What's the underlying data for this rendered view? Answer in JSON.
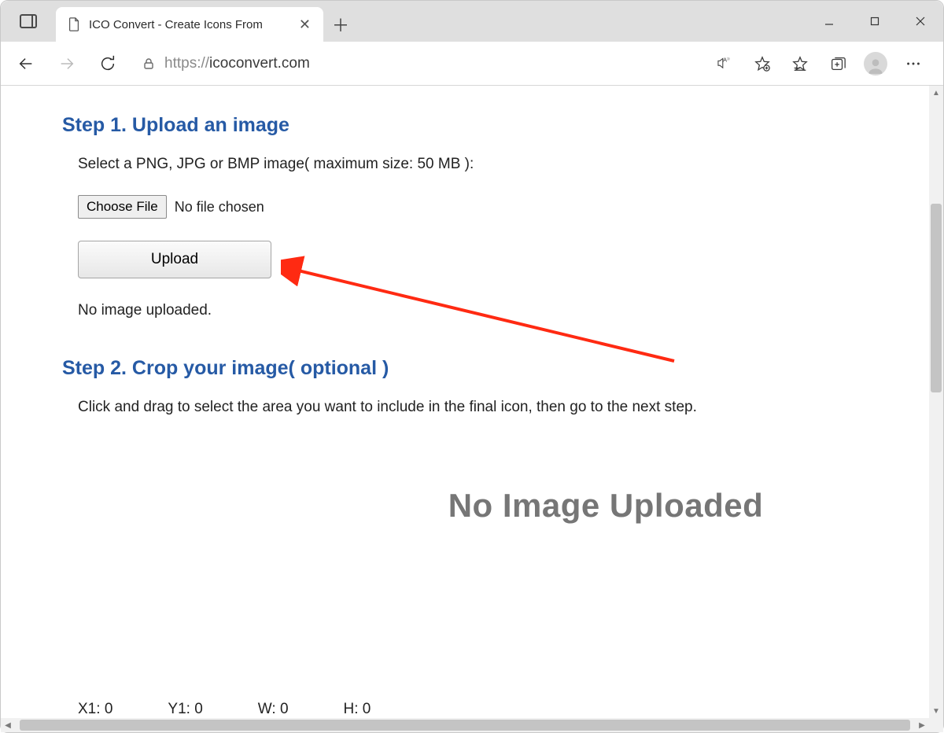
{
  "browser": {
    "tab_title": "ICO Convert - Create Icons From",
    "url_protocol": "https://",
    "url_host": "icoconvert.com"
  },
  "page": {
    "step1": {
      "heading": "Step 1. Upload an image",
      "instruction": "Select a PNG, JPG or BMP image( maximum size: 50 MB ):",
      "choose_label": "Choose File",
      "no_file_text": "No file chosen",
      "upload_label": "Upload",
      "status_text": "No image uploaded."
    },
    "step2": {
      "heading": "Step 2. Crop your image( optional )",
      "instruction": "Click and drag to select the area you want to include in the final icon, then go to the next step.",
      "placeholder_text": "No Image Uploaded"
    },
    "coords": {
      "x1_label": "X1:",
      "x1_val": "0",
      "y1_label": "Y1:",
      "y1_val": "0",
      "w_label": "W:",
      "w_val": "0",
      "h_label": "H:",
      "h_val": "0"
    }
  }
}
